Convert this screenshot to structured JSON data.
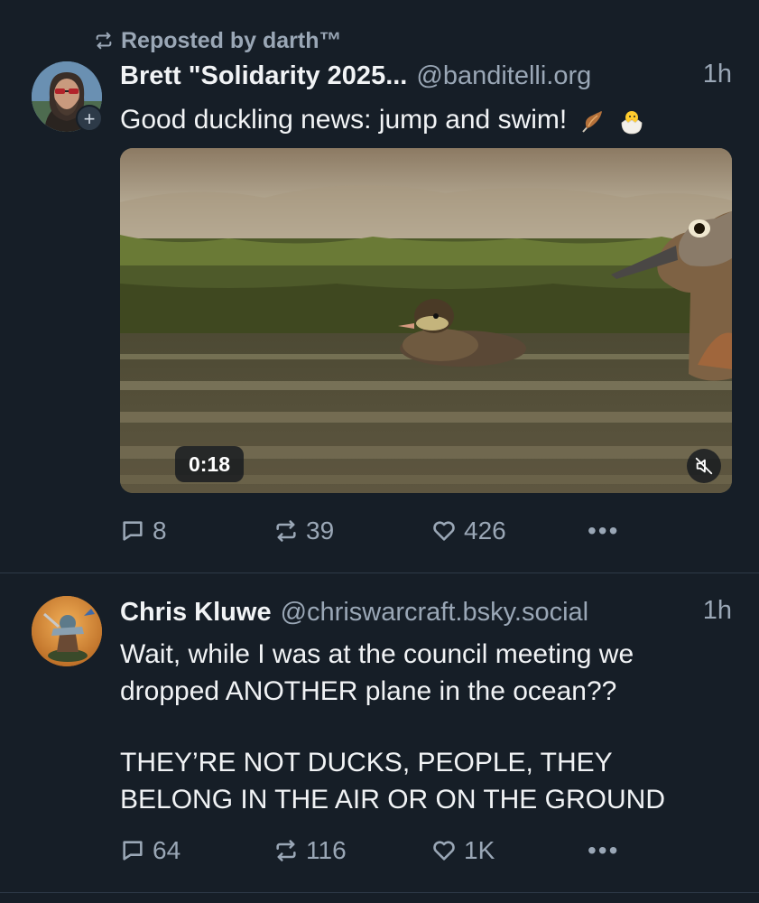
{
  "post1": {
    "repost_label": "Reposted by darth™",
    "author_name": "Brett \"Solidarity 2025...",
    "author_handle": "@banditelli.org",
    "time": "1h",
    "text": "Good duckling news: jump and swim!",
    "emoji": [
      "feather-emoji",
      "hatching-chick-emoji"
    ],
    "video": {
      "timecode": "0:18",
      "state": "playing",
      "muted": true
    },
    "stats": {
      "replies": "8",
      "reposts": "39",
      "likes": "426"
    }
  },
  "post2": {
    "author_name": "Chris Kluwe",
    "author_handle": "@chriswarcraft.bsky.social",
    "time": "1h",
    "text_p1": "Wait, while I was at the council meeting we\ndropped ANOTHER plane in the ocean??",
    "text_p2": "THEY’RE NOT DUCKS, PEOPLE, THEY\nBELONG IN THE AIR OR ON THE GROUND",
    "stats": {
      "replies": "64",
      "reposts": "116",
      "likes": "1K"
    }
  },
  "colors": {
    "background": "#161e27",
    "muted": "#9aa7b6",
    "divider": "#2e3a48"
  }
}
